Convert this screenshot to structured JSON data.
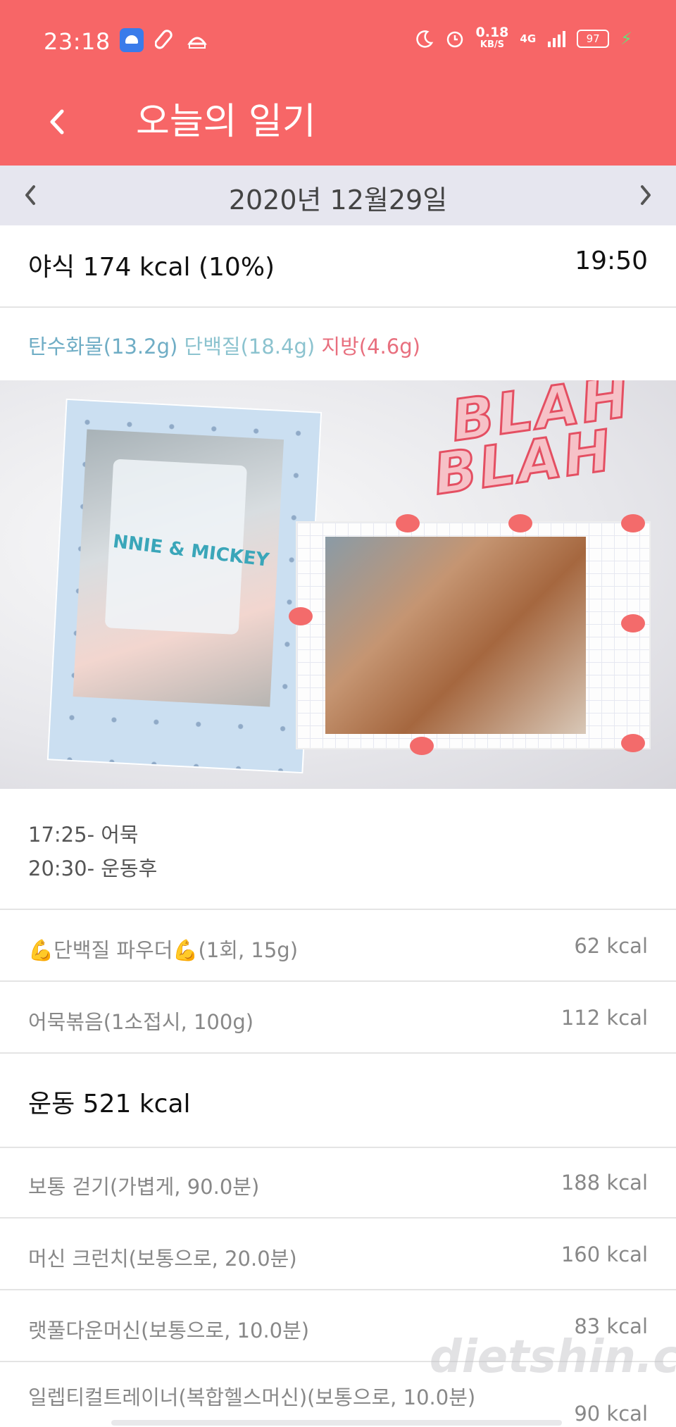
{
  "status_bar": {
    "time": "23:18",
    "network_speed": "0.18",
    "network_unit": "KB/S",
    "network_type": "4G",
    "battery": "97",
    "icons": [
      "android-app-icon",
      "pill-icon",
      "capsule-icon",
      "moon-icon",
      "alarm-icon",
      "signal-icon",
      "battery-icon",
      "charging-icon"
    ]
  },
  "header": {
    "title": "오늘의 일기",
    "back_icon": "chevron-left-icon"
  },
  "date_nav": {
    "date": "2020년 12월29일"
  },
  "meal": {
    "title": "야식 174 kcal (10%)",
    "time": "19:50",
    "carbs": "탄수화물(13.2g)",
    "protein": "단백질(18.4g)",
    "fat": "지방(4.6g)"
  },
  "photo": {
    "sticker_line1": "BLAH",
    "sticker_line2": "BLAH",
    "cup_text": "NNIE & MICKEY"
  },
  "memo": {
    "line1": "17:25- 어묵",
    "line2": "20:30- 운동후"
  },
  "foods": [
    {
      "name": "💪단백질 파우더💪(1회, 15g)",
      "kcal": "62 kcal"
    },
    {
      "name": "어묵볶음(1소접시, 100g)",
      "kcal": "112 kcal"
    }
  ],
  "exercise": {
    "title": "운동 521 kcal",
    "items": [
      {
        "name": "보통 걷기(가볍게, 90.0분)",
        "kcal": "188 kcal"
      },
      {
        "name": "머신 크런치(보통으로, 20.0분)",
        "kcal": "160 kcal"
      },
      {
        "name": "랫풀다운머신(보통으로, 10.0분)",
        "kcal": "83 kcal"
      },
      {
        "name": "일렙티컬트레이너(복합헬스머신)(보통으로, 10.0분)",
        "kcal": "90 kcal"
      }
    ]
  },
  "watermark": "dietshin.com",
  "colors": {
    "header": "#f76667",
    "carbs": "#6fadc5",
    "protein": "#8cc3cf",
    "fat": "#e86f7e"
  }
}
